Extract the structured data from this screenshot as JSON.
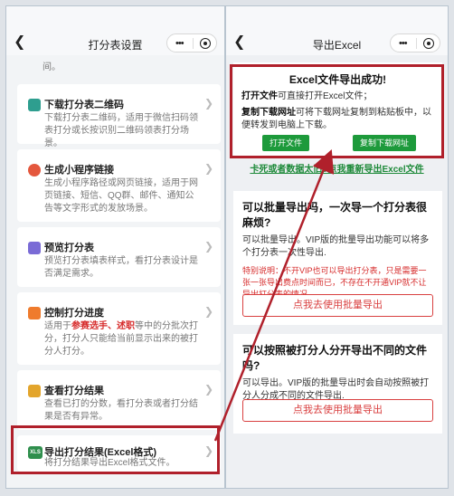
{
  "left": {
    "nav_title": "打分表设置",
    "cut_text": "间。",
    "items": [
      {
        "icon": "qrcode-icon",
        "color": "#2e9e8f",
        "name": "下载打分表二维码",
        "desc": "下载打分表二维码，适用于微信扫码领表打分或长按识别二维码领表打分场景。"
      },
      {
        "icon": "link-icon",
        "color": "#e4573d",
        "name": "生成小程序链接",
        "desc": "生成小程序路径或网页链接，适用于网页链接、短信、QQ群、邮件、通知公告等文字形式的发放场景。"
      },
      {
        "icon": "document-icon",
        "color": "#7a6bd6",
        "name": "预览打分表",
        "desc": "预览打分表填表样式，看打分表设计是否满足需求。"
      },
      {
        "icon": "progress-icon",
        "color": "#ef7b2d",
        "name": "控制打分进度",
        "desc_pre": "适用于",
        "desc_hl1": "参赛选手",
        "desc_mid": "、",
        "desc_hl2": "述职",
        "desc_post": "等中的分批次打分，打分人只能给当前显示出来的被打分人打分。"
      },
      {
        "icon": "search-result-icon",
        "color": "#e3a52c",
        "name": "查看打分结果",
        "desc": "查看已打的分数，看打分表或者打分结果是否有异常。"
      },
      {
        "icon": "excel-icon",
        "color": "#2f8f4d",
        "name": "导出打分结果(Excel格式)",
        "desc": "将打分结果导出Excel格式文件。",
        "badge": "XLS"
      }
    ]
  },
  "right": {
    "nav_title": "导出Excel",
    "success": {
      "title": "Excel文件导出成功!",
      "line1_b": "打开文件",
      "line1": "可直接打开Excel文件；",
      "line2_b": "复制下载网址",
      "line2": "可将下载网址复制到粘贴板中，以便转发到电脑上下载。",
      "open_btn": "打开文件",
      "copy_btn": "复制下载网址"
    },
    "retry_link": "卡死或者数据太旧?点我重新导出Excel文件",
    "faq1": {
      "q": "可以批量导出吗，一次导一个打分表很麻烦?",
      "a": "可以批量导出。VIP版的批量导出功能可以将多个打分表一次性导出.",
      "note": "特别说明：不开VIP也可以导出打分表，只是需要一张一张导出费点时间而已，不存在不开通VIP就不让导出打分表的情况。",
      "btn": "点我去使用批量导出"
    },
    "faq2": {
      "q": "可以按照被打分人分开导出不同的文件吗?",
      "a": "可以导出。VIP版的批量导出时会自动按照被打分人分成不同的文件导出.",
      "btn": "点我去使用批量导出"
    }
  },
  "colors": {
    "highlight": "#b0202b",
    "green": "#1d9a3b",
    "red": "#d94040"
  }
}
